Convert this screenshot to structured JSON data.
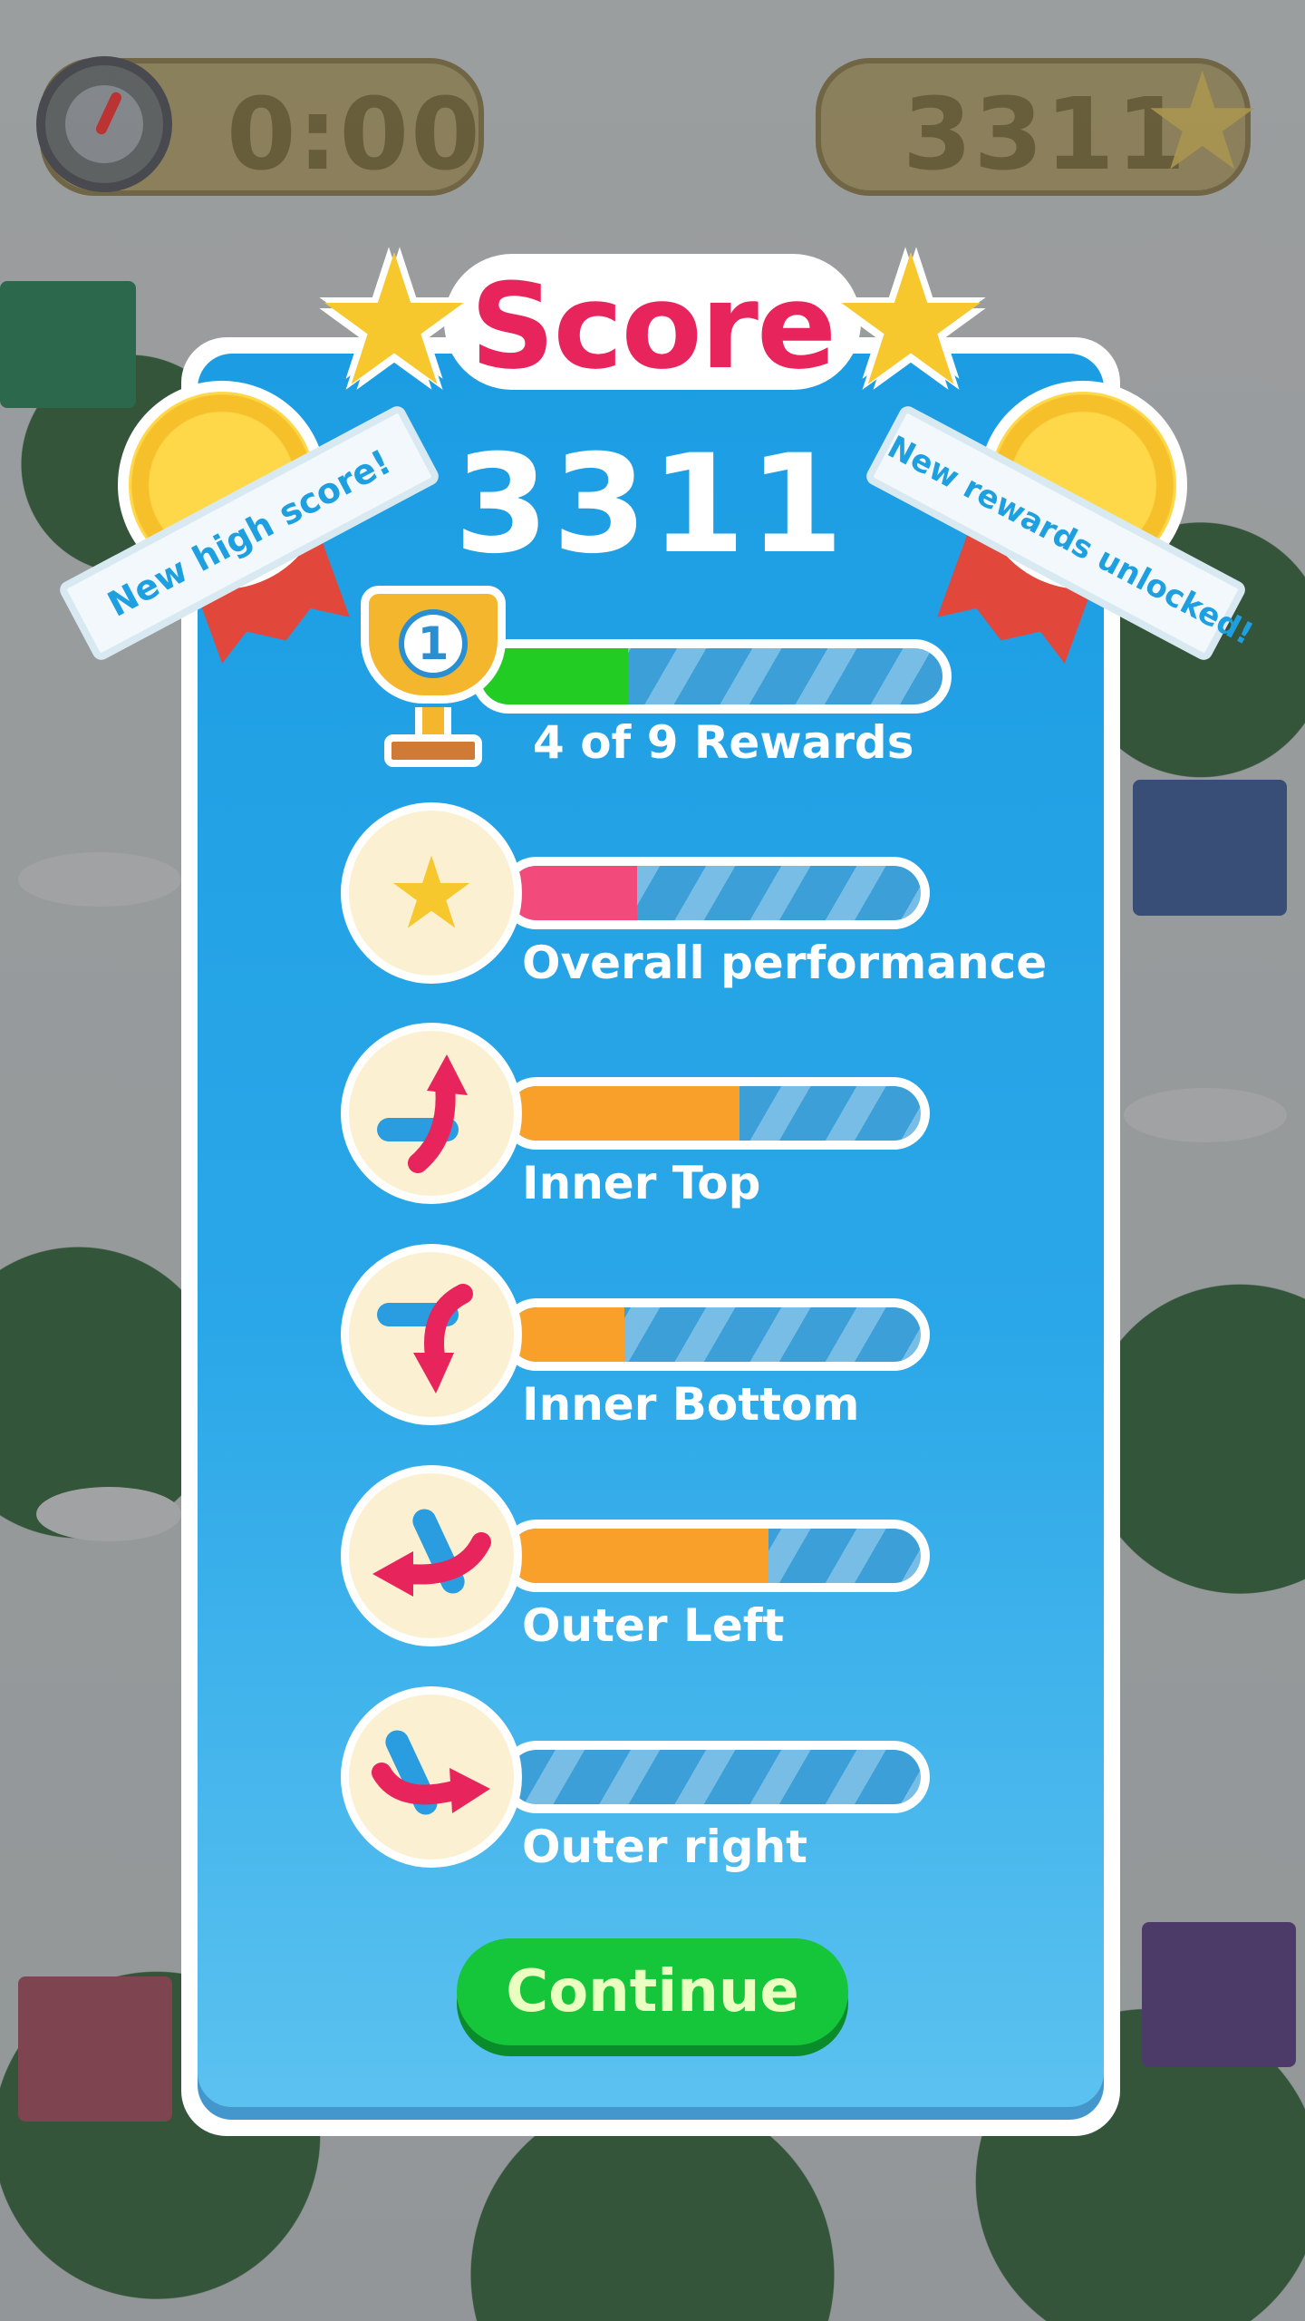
{
  "hud": {
    "timer": "0:00",
    "score": "3311"
  },
  "dialog": {
    "title": "Score",
    "score": "3311",
    "badge_left": "New high score!",
    "badge_right": "New rewards unlocked!",
    "rewards": {
      "label": "4 of 9 Rewards",
      "trophy_number": "1",
      "progress": 0.32,
      "color": "#22cc22"
    },
    "categories": [
      {
        "label": "Overall performance",
        "progress": 0.31,
        "color": "#f24a7a",
        "icon": "star-laurel-icon"
      },
      {
        "label": "Inner Top",
        "progress": 0.56,
        "color": "#f9a02a",
        "icon": "brush-arrow-up-icon"
      },
      {
        "label": "Inner Bottom",
        "progress": 0.28,
        "color": "#f9a02a",
        "icon": "brush-arrow-down-icon"
      },
      {
        "label": "Outer Left",
        "progress": 0.63,
        "color": "#f9a02a",
        "icon": "brush-arrow-left-icon"
      },
      {
        "label": "Outer right",
        "progress": 0.0,
        "color": "#f9a02a",
        "icon": "brush-arrow-right-icon"
      }
    ],
    "continue_label": "Continue"
  },
  "colors": {
    "panel_blue": "#1c9de3",
    "title_pink": "#e8245c",
    "button_green": "#15c53a"
  }
}
